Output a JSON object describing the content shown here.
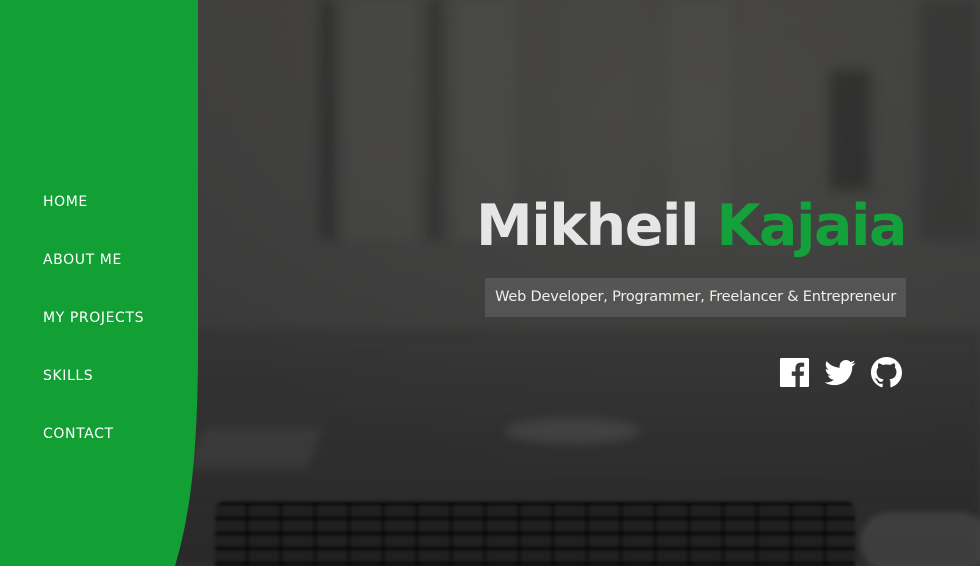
{
  "nav": {
    "items": [
      {
        "label": "HOME"
      },
      {
        "label": "ABOUT ME"
      },
      {
        "label": "MY PROJECTS"
      },
      {
        "label": "SKILLS"
      },
      {
        "label": "CONTACT"
      }
    ]
  },
  "hero": {
    "first_name": "Mikheil",
    "last_name": "Kajaia",
    "tagline": "Web Developer, Programmer, Freelancer & Entrepreneur"
  },
  "socials": [
    {
      "icon": "facebook-icon"
    },
    {
      "icon": "twitter-icon"
    },
    {
      "icon": "github-icon"
    }
  ],
  "colors": {
    "accent": "#12a035",
    "name_first": "#e6e6e6",
    "background": "#3a3a3a"
  }
}
